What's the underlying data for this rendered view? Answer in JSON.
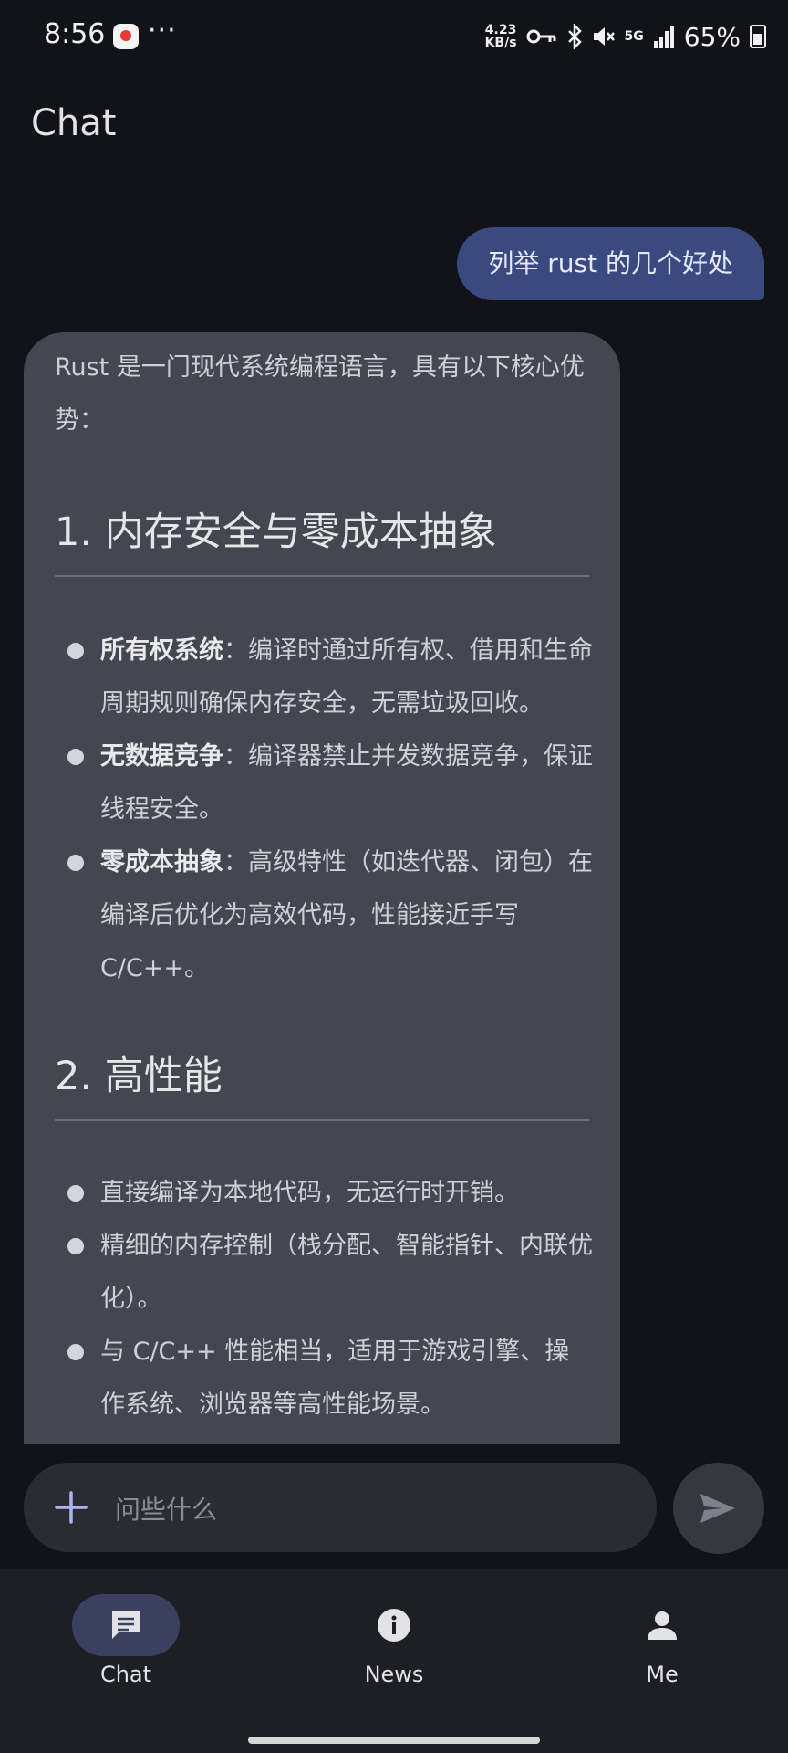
{
  "status_bar": {
    "time": "8:56",
    "more": "···",
    "net_speed_value": "4.23",
    "net_speed_unit": "KB/s",
    "network": "5G",
    "battery": "65%",
    "icons": [
      "app-notification-icon",
      "vpn-key-icon",
      "bluetooth-icon",
      "mute-icon",
      "signal-icon",
      "battery-charging-icon"
    ]
  },
  "header": {
    "title": "Chat"
  },
  "conversation": {
    "user_message": "列举 rust 的几个好处",
    "assistant": {
      "intro": "Rust 是一门现代系统编程语言，具有以下核心优势：",
      "sections": [
        {
          "heading": "1. 内存安全与零成本抽象",
          "items": [
            {
              "bold": "所有权系统",
              "text": "：编译时通过所有权、借用和生命周期规则确保内存安全，无需垃圾回收。"
            },
            {
              "bold": "无数据竞争",
              "text": "：编译器禁止并发数据竞争，保证线程安全。"
            },
            {
              "bold": "零成本抽象",
              "text": "：高级特性（如迭代器、闭包）在编译后优化为高效代码，性能接近手写 C/C++。"
            }
          ]
        },
        {
          "heading": "2. 高性能",
          "items": [
            {
              "bold": "",
              "text": "直接编译为本地代码，无运行时开销。"
            },
            {
              "bold": "",
              "text": "精细的内存控制（栈分配、智能指针、内联优化）。"
            },
            {
              "bold": "",
              "text": "与 C/C++ 性能相当，适用于游戏引擎、操作系统、浏览器等高性能场景。"
            }
          ]
        }
      ]
    }
  },
  "input": {
    "placeholder": "问些什么"
  },
  "nav": {
    "items": [
      {
        "label": "Chat",
        "icon": "chat-icon",
        "active": true
      },
      {
        "label": "News",
        "icon": "info-icon",
        "active": false
      },
      {
        "label": "Me",
        "icon": "person-icon",
        "active": false
      }
    ]
  },
  "colors": {
    "background": "#121318",
    "user_bubble": "#3a4a80",
    "assistant_bubble": "#44474f",
    "nav_active": "#3b4060",
    "accent": "#aab4f5"
  }
}
